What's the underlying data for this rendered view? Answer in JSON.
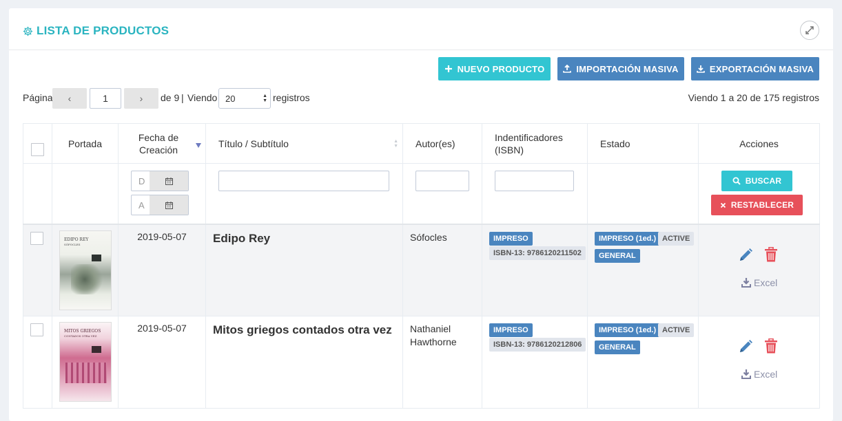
{
  "header": {
    "title": "LISTA DE PRODUCTOS",
    "icon": "gear-icon",
    "expand_icon": "expand-icon"
  },
  "toolbar": {
    "new_label": "NUEVO PRODUCTO",
    "import_label": "IMPORTACIÓN MASIVA",
    "export_label": "EXPORTACIÓN MASIVA"
  },
  "pager": {
    "page_label": "Página",
    "prev": "‹",
    "current_page": "1",
    "next": "›",
    "of_label": "de 9",
    "sep": "|",
    "viewing_label": "Viendo",
    "per_page": "20",
    "records_label": "registros",
    "summary": "Viendo 1 a 20 de 175 registros"
  },
  "table": {
    "columns": {
      "cover": "Portada",
      "date": "Fecha de Creación",
      "title": "Título / Subtítulo",
      "author": "Autor(es)",
      "ids": "Indentificadores (ISBN)",
      "status": "Estado",
      "actions": "Acciones"
    },
    "filters": {
      "date_from_placeholder": "D",
      "date_to_placeholder": "A",
      "search_label": "BUSCAR",
      "reset_label": "RESTABLECER"
    },
    "rows": [
      {
        "cover_title": "EDIPO REY",
        "cover_subtitle": "SÓFOCLES",
        "date": "2019-05-07",
        "title": "Edipo Rey",
        "author": "Sófocles",
        "format_tag": "IMPRESO",
        "isbn": "ISBN-13: 9786120211502",
        "status_edition": "IMPRESO (1ed.)",
        "status_state": "ACTIVE",
        "status_category": "GENERAL",
        "excel_label": "Excel"
      },
      {
        "cover_title": "MITOS GRIEGOS",
        "cover_subtitle": "CONTADOS OTRA VEZ",
        "date": "2019-05-07",
        "title": "Mitos griegos contados otra vez",
        "author": "Nathaniel Hawthorne",
        "format_tag": "IMPRESO",
        "isbn": "ISBN-13: 9786120212806",
        "status_edition": "IMPRESO (1ed.)",
        "status_state": "ACTIVE",
        "status_category": "GENERAL",
        "excel_label": "Excel"
      }
    ]
  },
  "colors": {
    "cyan": "#32c5d2",
    "blue": "#4a85bf",
    "red": "#e7505a",
    "edit": "#4a85bf",
    "delete": "#e7505a",
    "excel": "#8c90a8"
  }
}
